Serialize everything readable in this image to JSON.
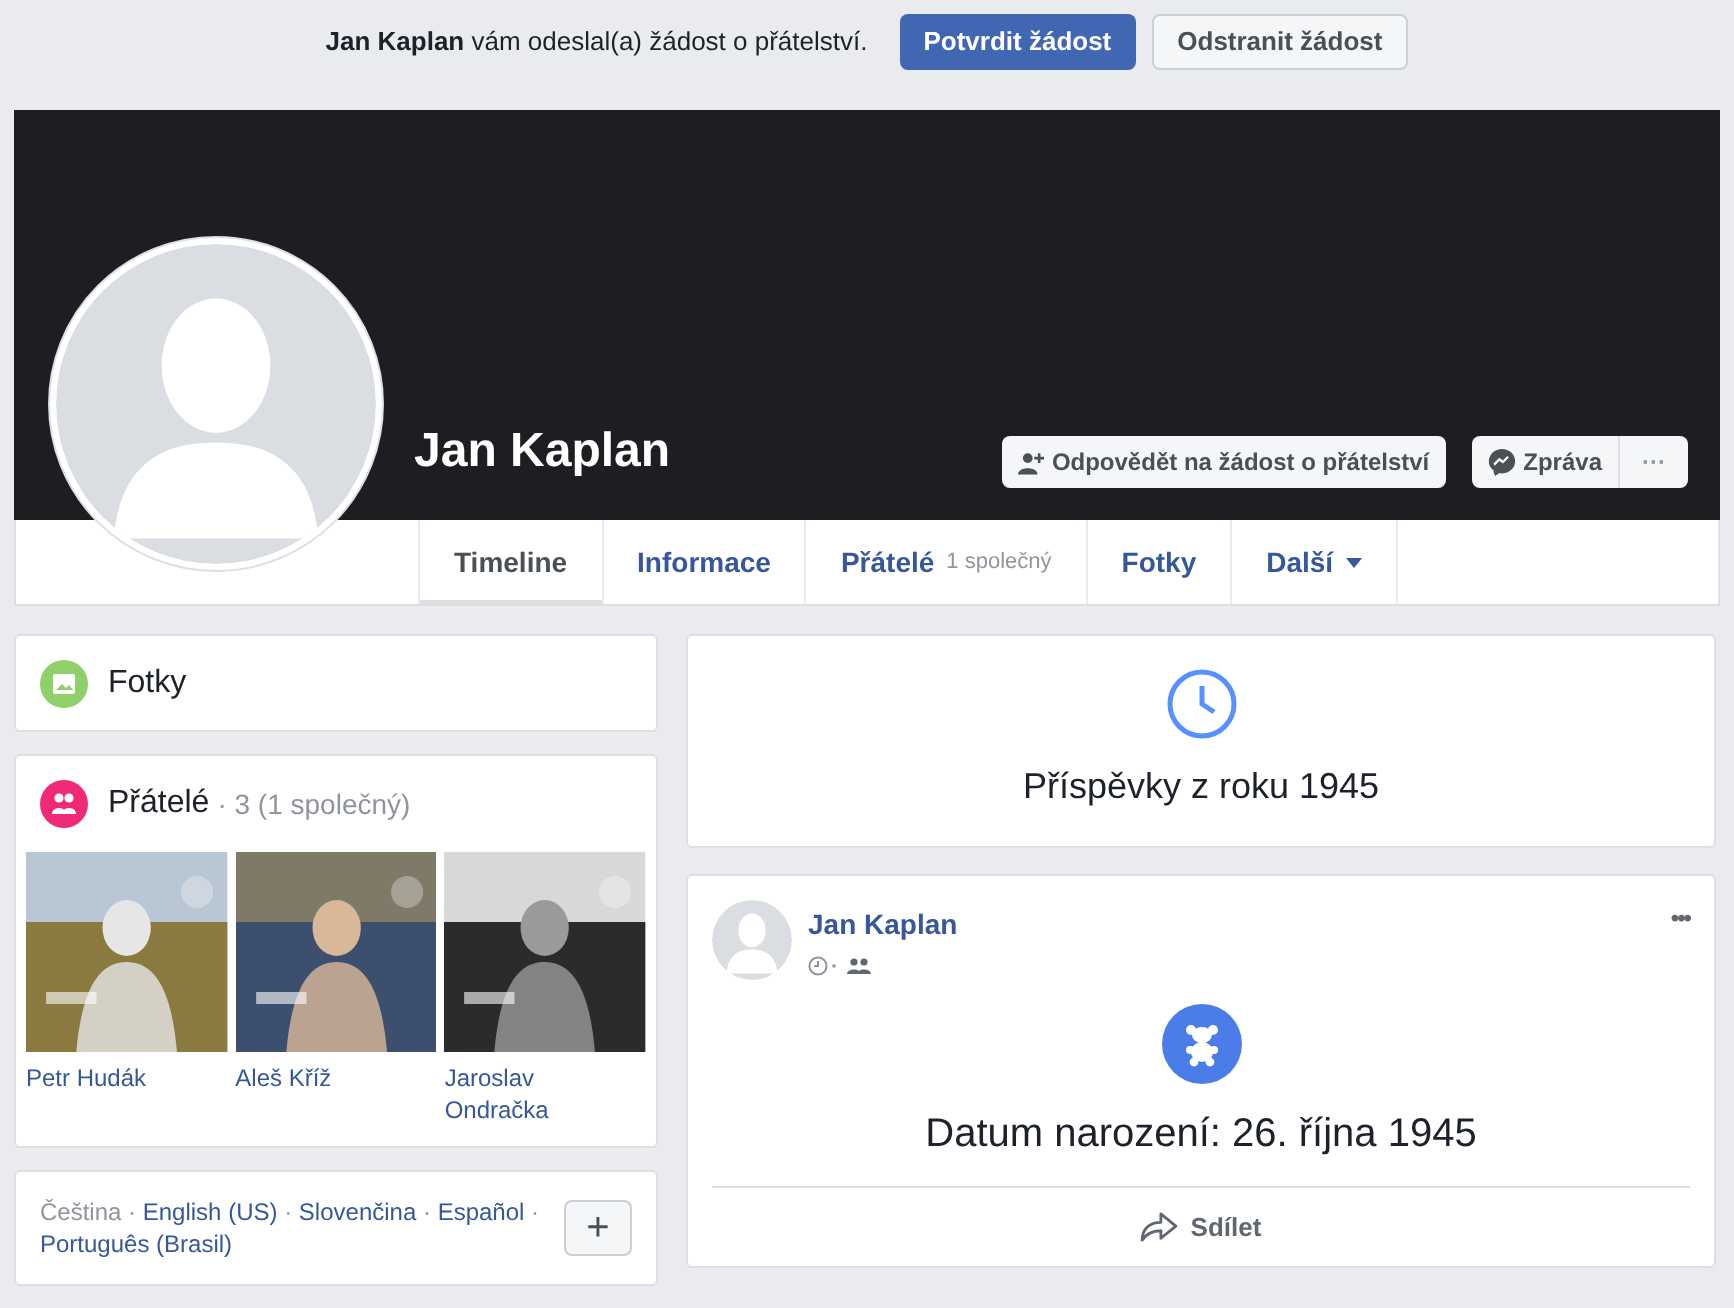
{
  "request_bar": {
    "name": "Jan Kaplan",
    "message": "vám odeslal(a) žádost o přátelství.",
    "buttons": [
      {
        "label": "Potvrdit žádost",
        "kind": "primary"
      },
      {
        "label": "Odstranit žádost",
        "kind": "secondary"
      }
    ]
  },
  "profile": {
    "name": "Jan Kaplan",
    "actions": [
      {
        "label": "Odpovědět na žádost o přátelství",
        "kind": "friend"
      },
      {
        "label": "Zpráva",
        "kind": "message"
      },
      {
        "label": "···",
        "kind": "more"
      }
    ]
  },
  "tabs": [
    {
      "label": "Timeline",
      "selected": true
    },
    {
      "label": "Informace",
      "selected": false
    },
    {
      "label": "Přátelé",
      "note": "1 společný",
      "selected": false
    },
    {
      "label": "Fotky",
      "selected": false
    },
    {
      "label": "Další",
      "dropdown": true,
      "selected": false
    }
  ],
  "photos_card": {
    "title": "Fotky"
  },
  "friends_card": {
    "title": "Přátelé",
    "count": "· 3 (1 společný)",
    "friends": [
      {
        "name": "Petr Hudák",
        "kind": "picture"
      },
      {
        "name": "Aleš Kříž",
        "kind": "picture"
      },
      {
        "name": "Jaroslav Ondračka",
        "kind": "picture"
      }
    ]
  },
  "languages": {
    "items": [
      {
        "label": "Čeština",
        "selected": true
      },
      {
        "label": "English (US)",
        "selected": false
      },
      {
        "label": "Slovenčina",
        "selected": false
      },
      {
        "label": "Español",
        "selected": false
      },
      {
        "label": "Português (Brasil)",
        "selected": false
      }
    ],
    "separator": "·",
    "add_button": "+"
  },
  "year_card": {
    "title": "Příspěvky z roku 1945"
  },
  "post": {
    "author": "Jan Kaplan",
    "menu": "•••",
    "event": "Datum narození: 26. října 1945",
    "share": "Sdílet"
  }
}
